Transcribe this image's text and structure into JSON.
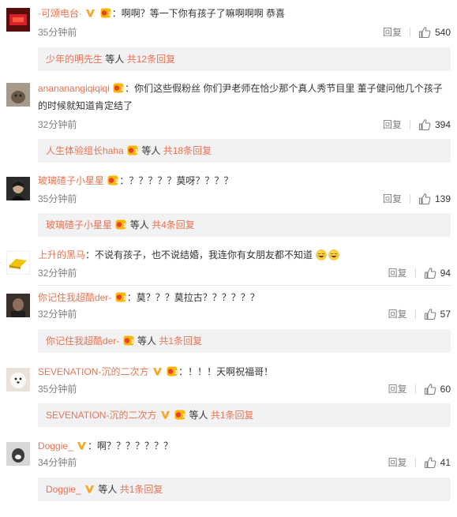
{
  "colors": {
    "accent": "#eb7350",
    "muted": "#808080",
    "subbg": "#f2f2f5"
  },
  "labels": {
    "reply": "回复",
    "by": "等人"
  },
  "comments": [
    {
      "user": "·可颂电台·",
      "text": "：啊啊？等一下你有孩子了嘛啊啊啊 恭喜",
      "time": "35分钟前",
      "likes": "540",
      "sub_user": "少年的明先生",
      "sub_total": "共12条回复"
    },
    {
      "user": "anananangiqiqiqi",
      "text": "：你们这些假粉丝 你们尹老师在恰少那个真人秀节目里 董子健问他几个孩子",
      "text2": "的时候就知道肯定结了",
      "time": "32分钟前",
      "likes": "394",
      "sub_user": "人生体验组长haha",
      "sub_total": "共18条回复"
    },
    {
      "user": "玻璃碴子小星星",
      "text": "：？？？？？莫呀？？？？",
      "time": "35分钟前",
      "likes": "139",
      "sub_user": "玻璃碴子小星星",
      "sub_total": "共4条回复"
    },
    {
      "user": "上升的黑马",
      "text": "：不说有孩子，也不说结婚，我连你有女朋友都不知道",
      "time": "32分钟前",
      "likes": "94"
    },
    {
      "user": "你记住我超酷der-",
      "text": "：莫？？？莫拉古？？？？？？",
      "time": "32分钟前",
      "likes": "57",
      "sub_user": "你记住我超酷der-",
      "sub_total": "共1条回复"
    },
    {
      "user": "SEVENATION-沉的二次方",
      "text": "：！！！天啊祝福哥！",
      "time": "35分钟前",
      "likes": "60",
      "sub_user": "SEVENATION-沉的二次方",
      "sub_total": "共1条回复"
    },
    {
      "user": "Doggie_",
      "text": "：啊？？？？？？？",
      "time": "34分钟前",
      "likes": "41",
      "sub_user": "Doggie_",
      "sub_total": "共1条回复"
    }
  ]
}
